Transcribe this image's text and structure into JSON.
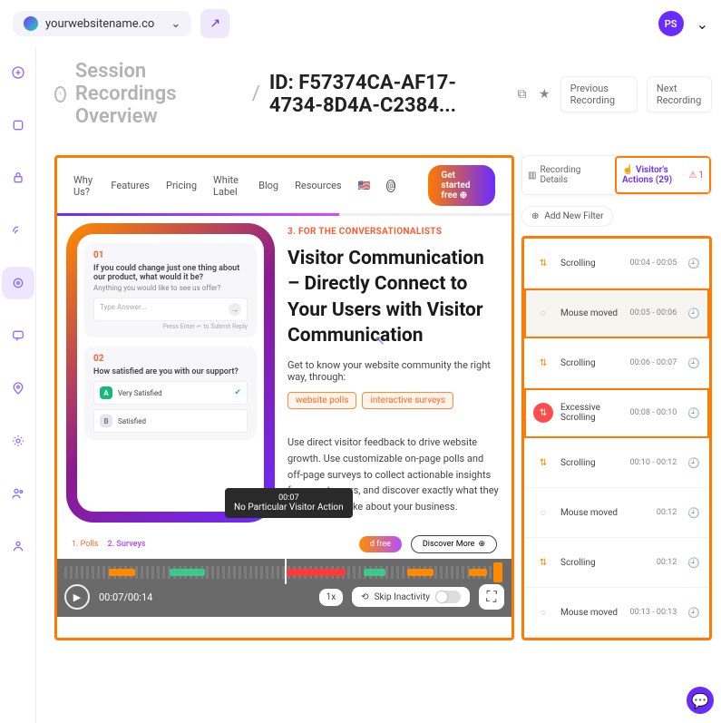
{
  "topbar": {
    "site": "yourwebsitename.co",
    "avatar": "PS"
  },
  "breadcrumb": {
    "overview": "Session Recordings Overview",
    "id": "ID: F57374CA-AF17-4734-8D4A-C2384...",
    "prev": "Previous Recording",
    "next": "Next Recording"
  },
  "sitenav": {
    "items": [
      "Why Us?",
      "Features",
      "Pricing",
      "White Label",
      "Blog",
      "Resources"
    ],
    "cta": "Get started free"
  },
  "page": {
    "eyebrow": "3. FOR THE CONVERSATIONALISTS",
    "title": "Visitor Communication – Directly Connect to Your Users with Visitor Communication",
    "lead": "Get to know your website community the right way, through:",
    "tags": [
      "website polls",
      "interactive surveys"
    ],
    "body": "Use direct visitor feedback to drive website growth. Use customizable on-page polls and off-page surveys to collect actionable insights from customers, and discover exactly what they like and don't like about your business.",
    "polls": "1. Polls",
    "surveys": "2. Surveys",
    "freebtn": "d free",
    "discover": "Discover More"
  },
  "mock": {
    "q1num": "01",
    "q1": "If you could change just one thing about our product, what would it be?",
    "q1sub": "Anything you would like to see us offer?",
    "q1ph": "Type Answer...",
    "q1hint": "Press Enter ↵ to Submit Reply",
    "q2num": "02",
    "q2": "How satisfied are you with our support?",
    "opt1": "Very Satisfied",
    "opt1b": "A",
    "opt2": "Satisfied",
    "opt2b": "B"
  },
  "tooltip": {
    "time": "00:07",
    "text": "No Particular Visitor Action"
  },
  "player": {
    "time": "00:07/00:14",
    "speed": "1x",
    "skip": "Skip Inactivity"
  },
  "tabs": {
    "details": "Recording Details",
    "actions": "Visitor's Actions (29)",
    "errors": "1"
  },
  "filter": "Add New Filter",
  "actions": [
    {
      "type": "scroll",
      "label": "Scrolling",
      "ts": "00:04 - 00:05"
    },
    {
      "type": "mouse",
      "label": "Mouse moved",
      "ts": "00:05 - 00:06",
      "selected": true
    },
    {
      "type": "scroll",
      "label": "Scrolling",
      "ts": "00:06 - 00:07"
    },
    {
      "type": "excess",
      "label": "Excessive Scrolling",
      "ts": "00:08 - 00:10"
    },
    {
      "type": "scroll",
      "label": "Scrolling",
      "ts": "00:10 - 00:12"
    },
    {
      "type": "mouse",
      "label": "Mouse moved",
      "ts": "00:12"
    },
    {
      "type": "scroll",
      "label": "Scrolling",
      "ts": "00:12"
    },
    {
      "type": "mouse",
      "label": "Mouse moved",
      "ts": "00:13 - 00:13"
    }
  ]
}
